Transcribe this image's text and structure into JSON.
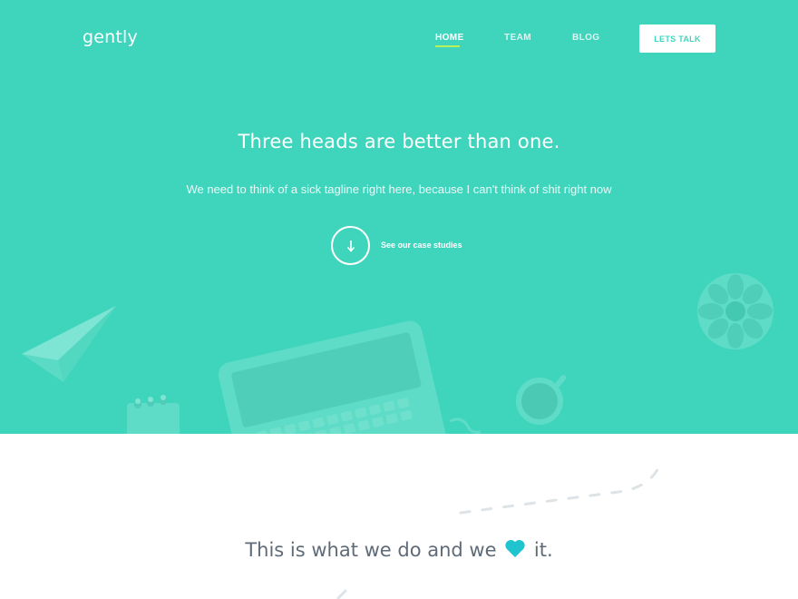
{
  "brand": {
    "logo": "gently"
  },
  "nav": {
    "items": [
      {
        "label": "HOME",
        "active": true
      },
      {
        "label": "TEAM",
        "active": false
      },
      {
        "label": "BLOG",
        "active": false
      }
    ],
    "cta_label": "LETS TALK"
  },
  "hero": {
    "headline": "Three heads are better than one.",
    "tagline": "We need to think of a sick tagline right here, because I can't think of shit right now",
    "scroll_icon": "arrow-down-icon",
    "case_link": "See our case studies"
  },
  "section": {
    "title_before": "This is what we do and we",
    "title_after": "it.",
    "heart_icon": "heart-icon"
  },
  "colors": {
    "hero_bg": "#3fd5bd",
    "accent_underline": "#b6f05a",
    "heart": "#1fc4cf",
    "section_text": "#5f6b78"
  }
}
